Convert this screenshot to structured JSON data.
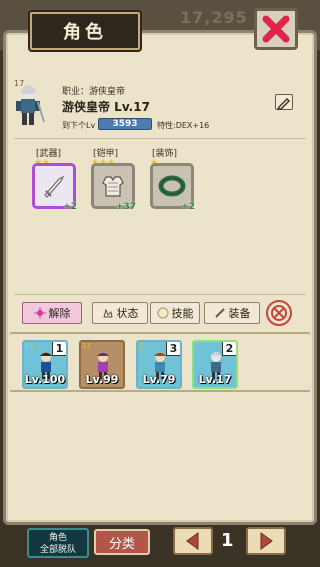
{
  "header": {
    "title": "角色",
    "gold": "17,295"
  },
  "character": {
    "level_badge": "17",
    "job_label": "职业：游侠皇帝",
    "name": "游侠皇帝 Lv.17",
    "next_label": "到下个Lv",
    "xp_value": "3593",
    "trait": "特性:DEX+16"
  },
  "equipment": [
    {
      "label": "[武器]",
      "bonus": "+2",
      "stars": "★★",
      "icon": "sword-icon",
      "border": "#b24bd8"
    },
    {
      "label": "[铠甲]",
      "bonus": "+37",
      "stars": "★★★",
      "icon": "armor-icon",
      "border": "#8c8578"
    },
    {
      "label": "[装饰]",
      "bonus": "+2",
      "stars": "★",
      "icon": "ring-icon",
      "border": "#8c8578"
    }
  ],
  "tabs": {
    "release": "解除",
    "status": "状态",
    "skill": "技能",
    "equip": "装备"
  },
  "party": [
    {
      "level": "Lv.100",
      "slot": "1",
      "badge": "11",
      "color": "#70c3d6"
    },
    {
      "level": "Lv.99",
      "slot": "",
      "badge": "11",
      "color": "#b59067"
    },
    {
      "level": "Lv.79",
      "slot": "3",
      "badge": "2",
      "color": "#70c3d6"
    },
    {
      "level": "Lv.17",
      "slot": "2",
      "badge": "7",
      "color": "#70c3d6"
    }
  ],
  "footer": {
    "all_line1": "角色",
    "all_line2": "全部脱队",
    "category": "分类",
    "page": "1"
  }
}
